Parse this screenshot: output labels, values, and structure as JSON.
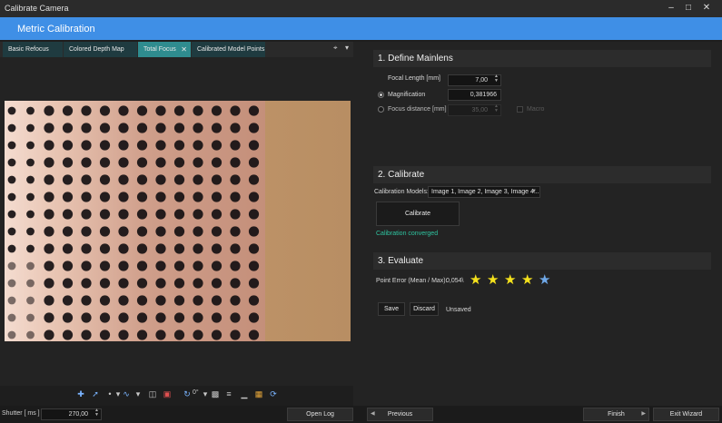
{
  "window": {
    "title": "Calibrate Camera",
    "minimize": "–",
    "maximize": "□",
    "close": "✕"
  },
  "banner": {
    "title": "Metric Calibration"
  },
  "tabs": [
    {
      "label": "Basic Refocus"
    },
    {
      "label": "Colored Depth Map"
    },
    {
      "label": "Total Focus",
      "close": "✕"
    },
    {
      "label": "Calibrated Model Points"
    }
  ],
  "tab_controls": {
    "pin": "⌖",
    "menu": "▾"
  },
  "toolbar": {
    "rotation": "0°"
  },
  "bottom": {
    "shutter_label": "Shutter [ ms ]",
    "shutter_value": "270,00",
    "open_log": "Open Log",
    "previous": "Previous",
    "finish": "Finish",
    "exit": "Exit Wizard"
  },
  "mainlens": {
    "title": "1. Define Mainlens",
    "focal_label": "Focal Length [mm]",
    "focal_value": "7,00",
    "magnification_label": "Magnification",
    "magnification_value": "0,381966",
    "focus_label": "Focus distance [mm]",
    "focus_value": "35,00",
    "macro_label": "Macro"
  },
  "calibrate": {
    "title": "2. Calibrate",
    "models_label": "Calibration Models:",
    "models_value": "Image 1, Image 2, Image 3, Image 4...",
    "button": "Calibrate",
    "status": "Calibration converged"
  },
  "evaluate": {
    "title": "3. Evaluate",
    "point_error_label": "Point Error (Mean / Max):",
    "point_error_value": "0,054\\",
    "rating": 4,
    "rating_max": 5,
    "star_color": "#f5e21c",
    "star_empty_color": "#6fa8e8",
    "save": "Save",
    "discard": "Discard",
    "state": "Unsaved"
  }
}
